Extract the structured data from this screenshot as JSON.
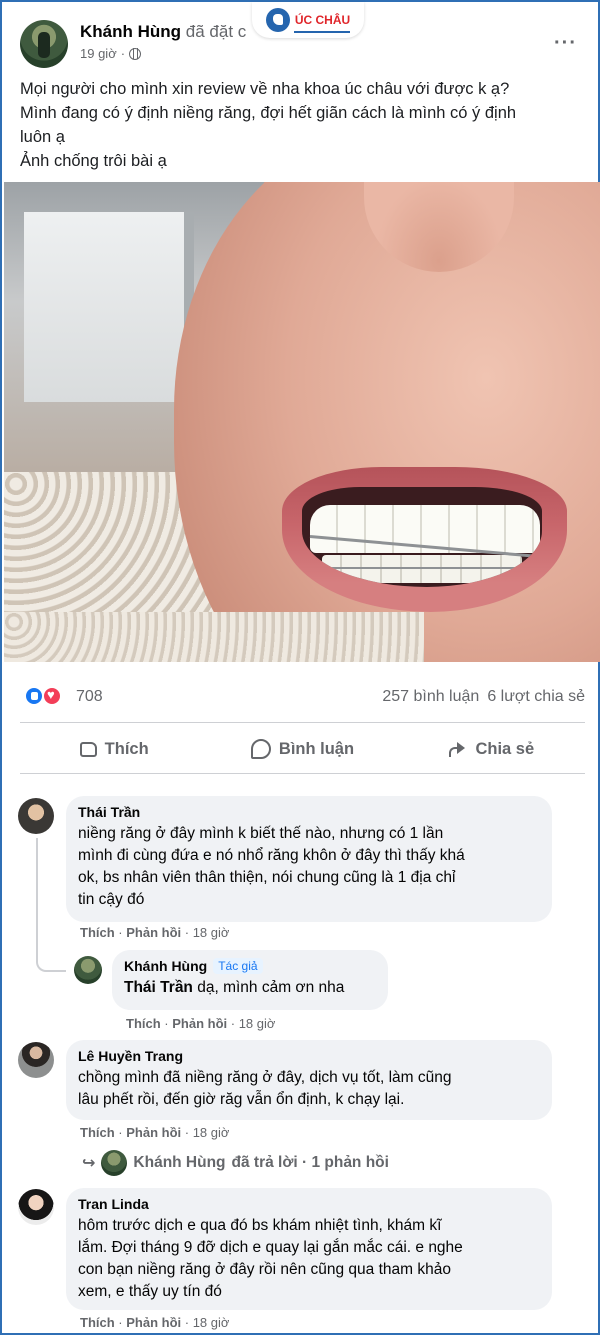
{
  "logo": {
    "text": "ÚC CHÂU"
  },
  "post": {
    "author": "Khánh Hùng",
    "action": "đã đặt c",
    "time": "19 giờ",
    "text_lines": [
      "Mọi người cho mình xin review về nha khoa úc châu với được k ạ?",
      "Mình đang có ý định niềng răng, đợi hết giãn cách là mình có ý định",
      "luôn ạ",
      "Ảnh chống trôi bài ạ"
    ],
    "more_icon": "more-horizontal-icon"
  },
  "stats": {
    "reactions": "708",
    "comments": "257 bình luận",
    "shares": "6 lượt chia sẻ"
  },
  "actions": {
    "like": "Thích",
    "comment": "Bình luận",
    "share": "Chia sẻ"
  },
  "comments": [
    {
      "name": "Thái Trần",
      "lines": [
        "niềng răng ở đây mình k biết thế nào, nhưng có 1 lần",
        "mình đi cùng đứa e nó nhổ răng khôn ở đây thì thấy khá",
        "ok, bs nhân viên thân thiện, nói chung cũng là 1 địa chỉ",
        "tin cậy đó"
      ],
      "like": "Thích",
      "reply": "Phản hồi",
      "time": "18 giờ"
    },
    {
      "name": "Lê Huyền Trang",
      "lines": [
        "chồng mình đã niềng răng ở đây, dịch vụ tốt, làm cũng",
        "lâu phết rồi, đến giờ răg vẫn ổn định, k chạy lại."
      ],
      "like": "Thích",
      "reply": "Phản hồi",
      "time": "18 giờ"
    },
    {
      "name": "Tran Linda",
      "lines": [
        "hôm trước dịch e qua đó bs khám nhiệt tình, khám kĩ",
        "lắm. Đợi tháng 9 đỡ dịch e quay lại gắn mắc cái. e nghe",
        "con bạn niềng răng ở đây rồi nên cũng qua tham khảo",
        "xem, e thấy uy tín đó"
      ],
      "like": "Thích",
      "reply": "Phản hồi",
      "time": "18 giờ"
    }
  ],
  "reply": {
    "name": "Khánh Hùng",
    "badge": "Tác giả",
    "tagged": "Thái Trần",
    "text": "dạ, mình cảm ơn nha",
    "like": "Thích",
    "reply": "Phản hồi",
    "time": "18 giờ"
  },
  "view_replies": {
    "name": "Khánh Hùng",
    "text": "đã trả lời · 1 phản hồi"
  },
  "colors": {
    "accent": "#1877f2",
    "love": "#f33e58",
    "frame": "#2f6fb5"
  }
}
